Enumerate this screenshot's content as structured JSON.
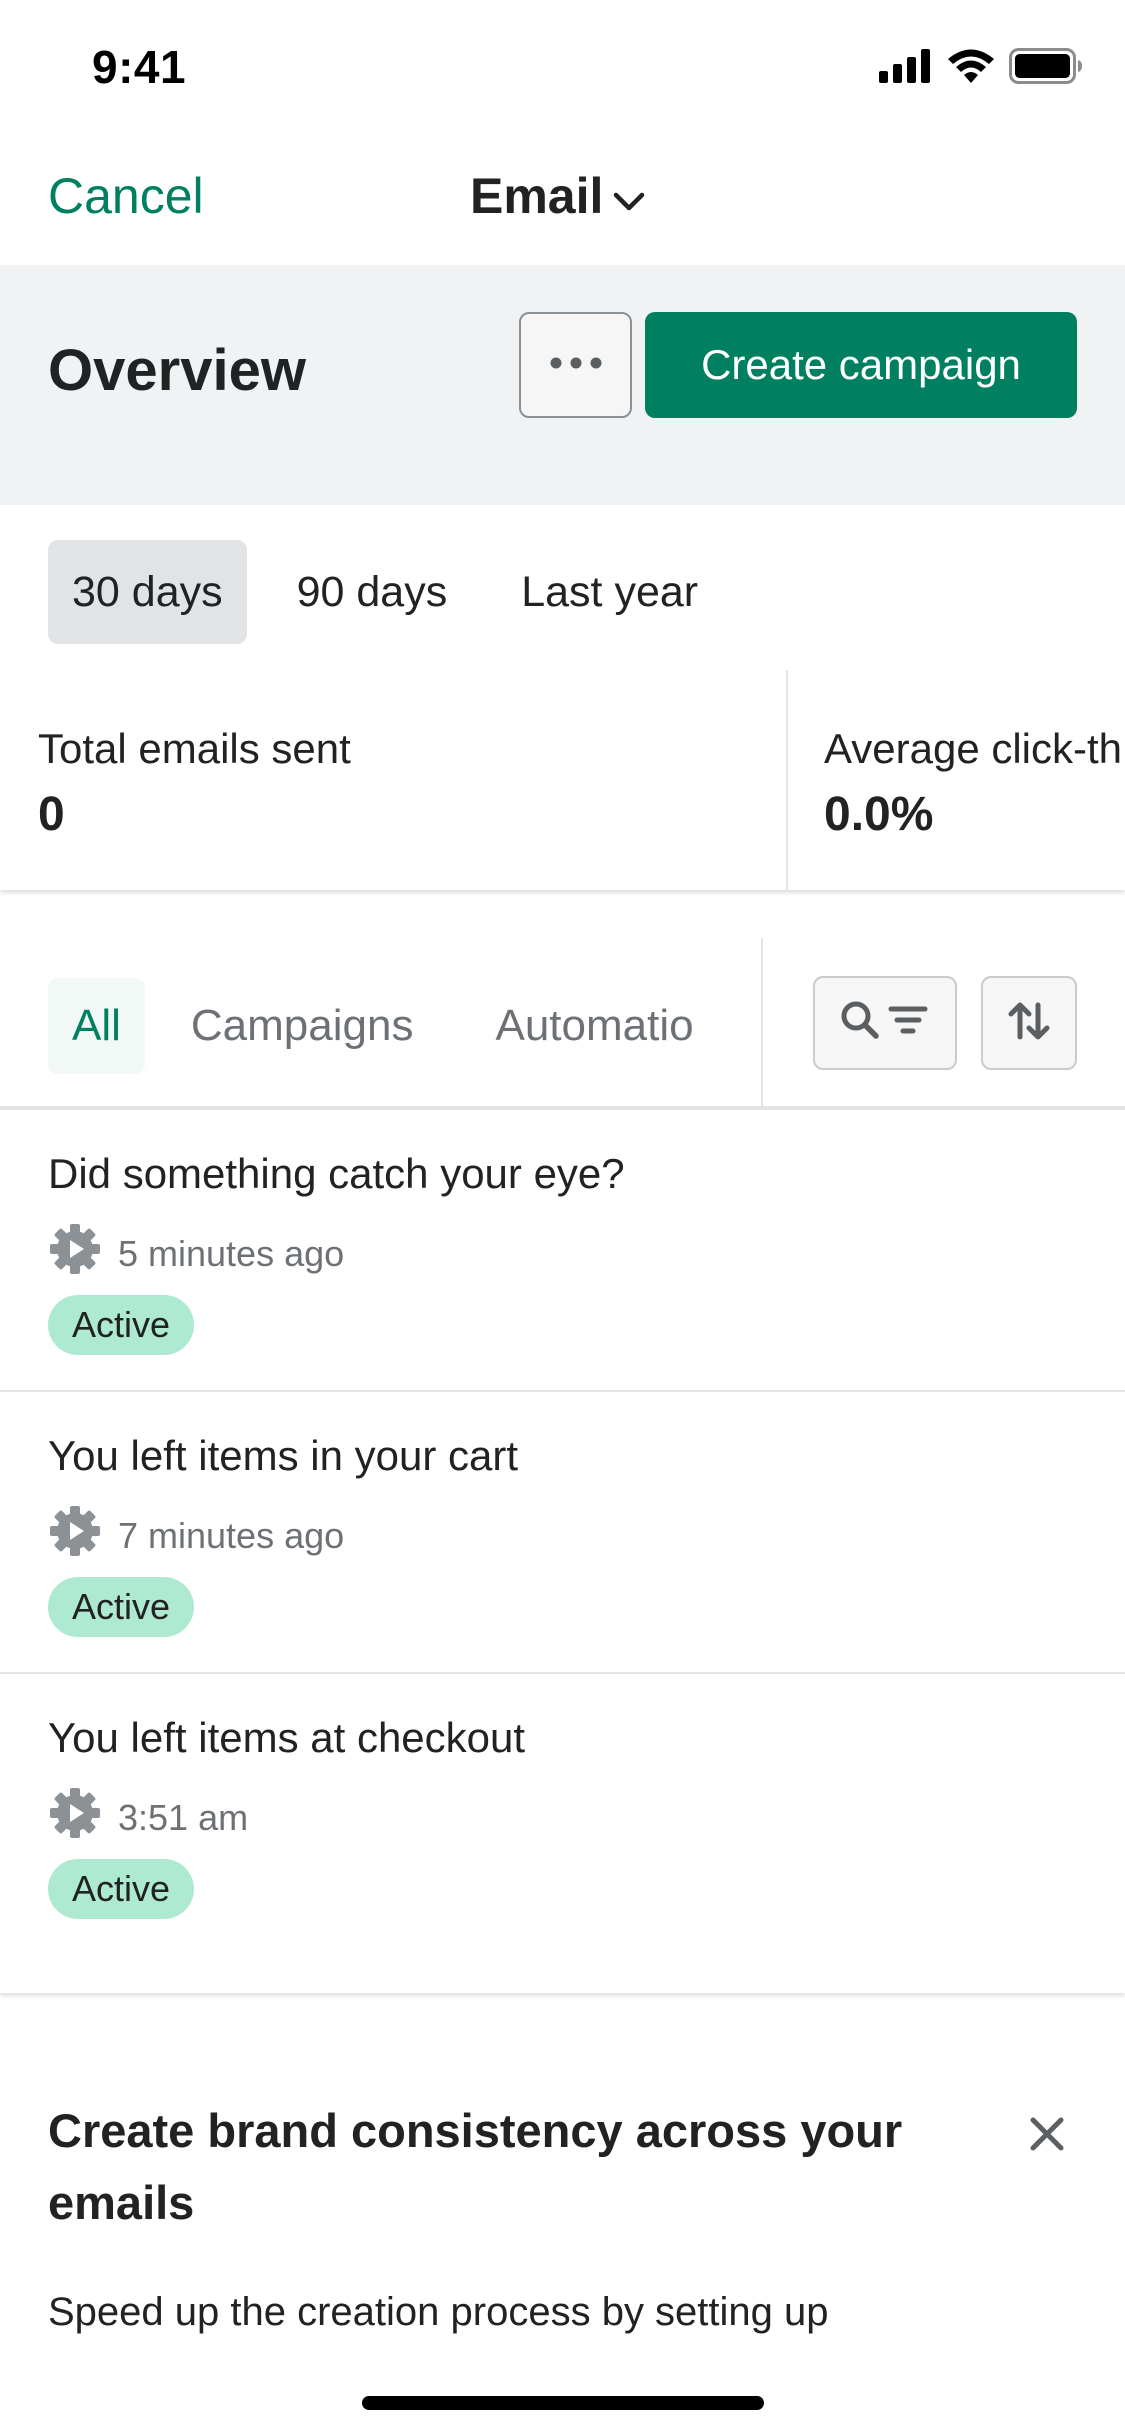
{
  "status_bar": {
    "time": "9:41",
    "icons": [
      "cellular-signal-icon",
      "wifi-icon",
      "battery-icon"
    ]
  },
  "nav": {
    "cancel_label": "Cancel",
    "title": "Email",
    "title_icon": "chevron-down-icon"
  },
  "overview": {
    "title": "Overview",
    "more_icon": "ellipsis-icon",
    "create_label": "Create campaign"
  },
  "date_ranges": {
    "tabs": [
      {
        "label": "30 days",
        "selected": true
      },
      {
        "label": "90 days",
        "selected": false
      },
      {
        "label": "Last year",
        "selected": false
      }
    ]
  },
  "metrics": [
    {
      "label": "Total emails sent",
      "value": "0"
    },
    {
      "label": "Average click-th",
      "value": "0.0%"
    }
  ],
  "filters": {
    "tabs": [
      {
        "label": "All",
        "selected": true
      },
      {
        "label": "Campaigns",
        "selected": false
      },
      {
        "label": "Automatio",
        "selected": false
      }
    ],
    "search_filter_icon": "search-filter-icon",
    "sort_icon": "sort-icon"
  },
  "list": [
    {
      "title": "Did something catch your eye?",
      "time": "5 minutes ago",
      "status": "Active",
      "icon": "automation-gear-icon"
    },
    {
      "title": "You left items in your cart",
      "time": "7 minutes ago",
      "status": "Active",
      "icon": "automation-gear-icon"
    },
    {
      "title": "You left items at checkout",
      "time": "3:51 am",
      "status": "Active",
      "icon": "automation-gear-icon"
    }
  ],
  "promo": {
    "title": "Create brand consistency across your emails",
    "body": "Speed up the creation process by setting up",
    "close_icon": "close-icon"
  },
  "colors": {
    "accent": "#008060",
    "badge_bg": "#aee9d1",
    "header_bg": "#f1f2f3"
  }
}
